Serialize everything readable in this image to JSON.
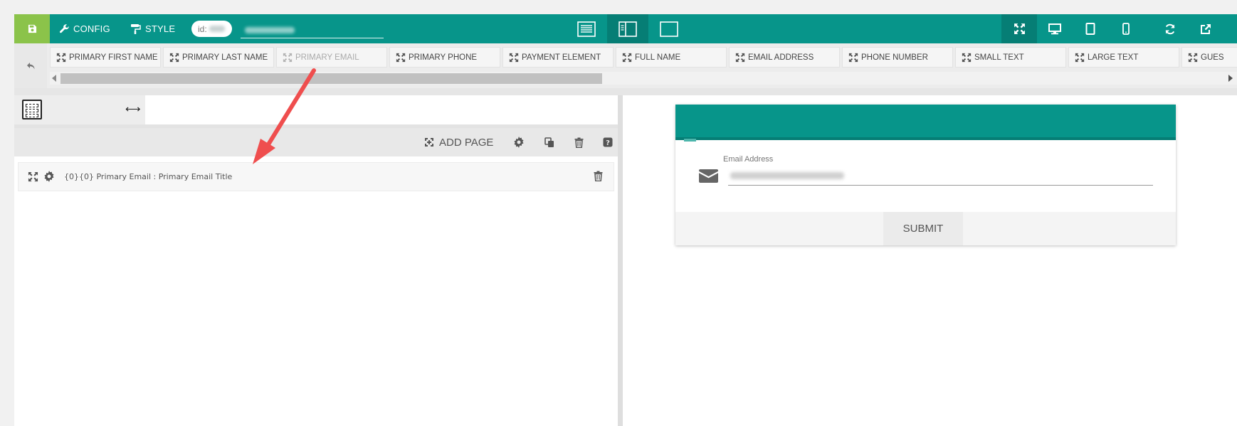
{
  "toolbar": {
    "config_label": "CONFIG",
    "style_label": "STYLE",
    "id_label": "id:"
  },
  "palette": {
    "items": [
      {
        "label": "PRIMARY FIRST NAME",
        "disabled": false
      },
      {
        "label": "PRIMARY LAST NAME",
        "disabled": false
      },
      {
        "label": "PRIMARY EMAIL",
        "disabled": true
      },
      {
        "label": "PRIMARY PHONE",
        "disabled": false
      },
      {
        "label": "PAYMENT ELEMENT",
        "disabled": false
      },
      {
        "label": "FULL NAME",
        "disabled": false
      },
      {
        "label": "EMAIL ADDRESS",
        "disabled": false
      },
      {
        "label": "PHONE NUMBER",
        "disabled": false
      },
      {
        "label": "SMALL TEXT",
        "disabled": false
      },
      {
        "label": "LARGE TEXT",
        "disabled": false
      },
      {
        "label": "GUES",
        "disabled": false
      }
    ]
  },
  "editor": {
    "add_page_label": "ADD PAGE",
    "element_text": "{0}{0} Primary Email : Primary Email Title"
  },
  "preview": {
    "email_label": "Email Address",
    "submit_label": "SUBMIT"
  },
  "colors": {
    "toolbar": "#07958a",
    "toolbar_active": "#067e75",
    "save_button": "#8bc34a",
    "annotation_arrow": "#ef4e4e"
  },
  "icons": {
    "save": "floppy-icon",
    "config": "wrench-icon",
    "style": "paint-roller-icon",
    "undo": "undo-icon",
    "expand": "expand-arrows-icon",
    "settings": "gear-icon",
    "copy": "copy-icon",
    "delete": "trash-icon",
    "help": "help-icon",
    "email": "envelope-icon"
  }
}
